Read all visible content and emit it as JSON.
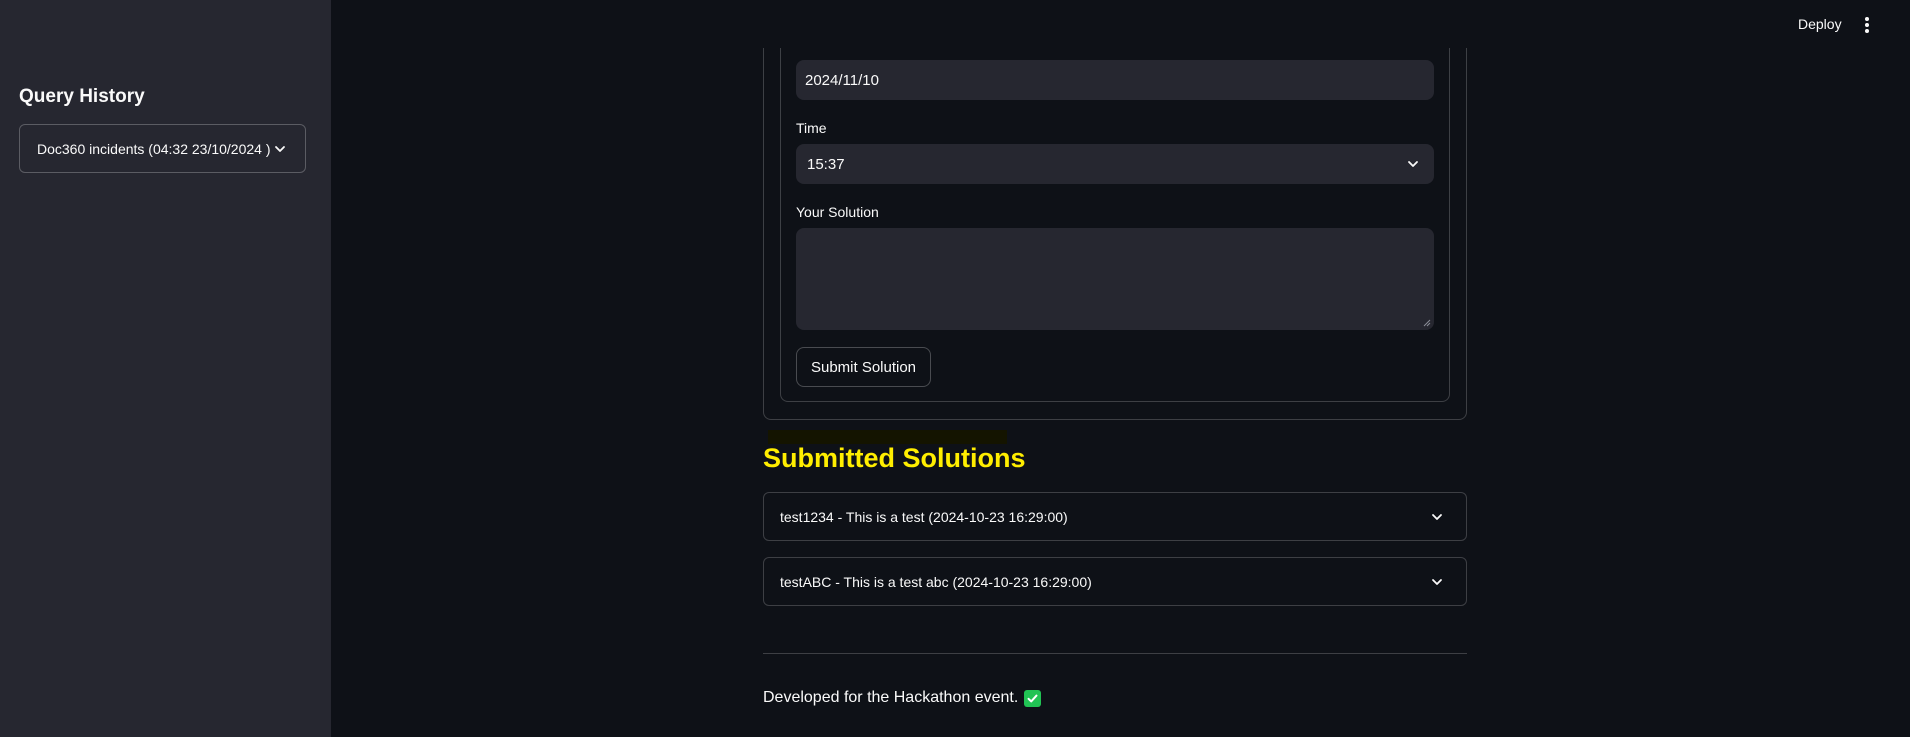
{
  "sidebar": {
    "title": "Query History",
    "history_select": {
      "value": "Doc360 incidents (04:32 23/10/2024 )",
      "icon": "chevron-down-icon"
    }
  },
  "header": {
    "deploy_label": "Deploy",
    "menu_icon": "kebab-menu-icon"
  },
  "form": {
    "date_value": "2024/11/10",
    "time_label": "Time",
    "time_value": "15:37",
    "solution_label": "Your Solution",
    "solution_value": "",
    "submit_label": "Submit Solution"
  },
  "solutions": {
    "title": "Submitted Solutions",
    "title_color": "#ffee00",
    "items": [
      {
        "label": "test1234 - This is a test (2024-10-23 16:29:00)"
      },
      {
        "label": "testABC - This is a test abc (2024-10-23 16:29:00)"
      }
    ]
  },
  "footer": {
    "text": "Developed for the Hackathon event.",
    "icon": "check-mark-icon",
    "icon_color": "#21c354"
  },
  "colors": {
    "background": "#0e1117",
    "sidebar": "#262730",
    "input": "#262730"
  }
}
